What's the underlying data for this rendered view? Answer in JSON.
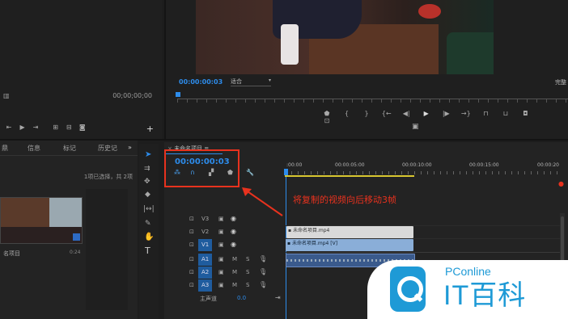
{
  "source_monitor": {
    "timecode": "00;00;00;00"
  },
  "program_monitor": {
    "timecode": "00:00:00:03",
    "fit_label": "适合",
    "quality_label": "完整"
  },
  "project_panel": {
    "tabs": [
      "鼎",
      "信息",
      "标记",
      "历史记"
    ],
    "more": "»",
    "selection_status": "1项已选择，共 2项",
    "clip_label": "名项目",
    "clip_duration": "0:24"
  },
  "timeline": {
    "sequence_tab": "未命名项目",
    "menu_glyph": "≡",
    "timecode": "00:00:00:03",
    "ruler": [
      ":00:00",
      "00:00:05:00",
      "00:00:10:00",
      "00:00:15:00",
      "00:00:20"
    ],
    "tracks": [
      {
        "name": "V3",
        "type": "video"
      },
      {
        "name": "V2",
        "type": "video"
      },
      {
        "name": "V1",
        "type": "video",
        "active": true
      },
      {
        "name": "A1",
        "type": "audio"
      },
      {
        "name": "A2",
        "type": "audio"
      },
      {
        "name": "A3",
        "type": "audio"
      }
    ],
    "master_label": "主声道",
    "master_value": "0.0",
    "clips": {
      "v2": "未命名项目.mp4",
      "v1": "未命名项目.mp4 [V]"
    }
  },
  "annotation": {
    "text": "将复制的视频向后移动3帧",
    "color": "#e8321e"
  },
  "watermark": {
    "brand": "PConline",
    "name": "IT百科"
  }
}
